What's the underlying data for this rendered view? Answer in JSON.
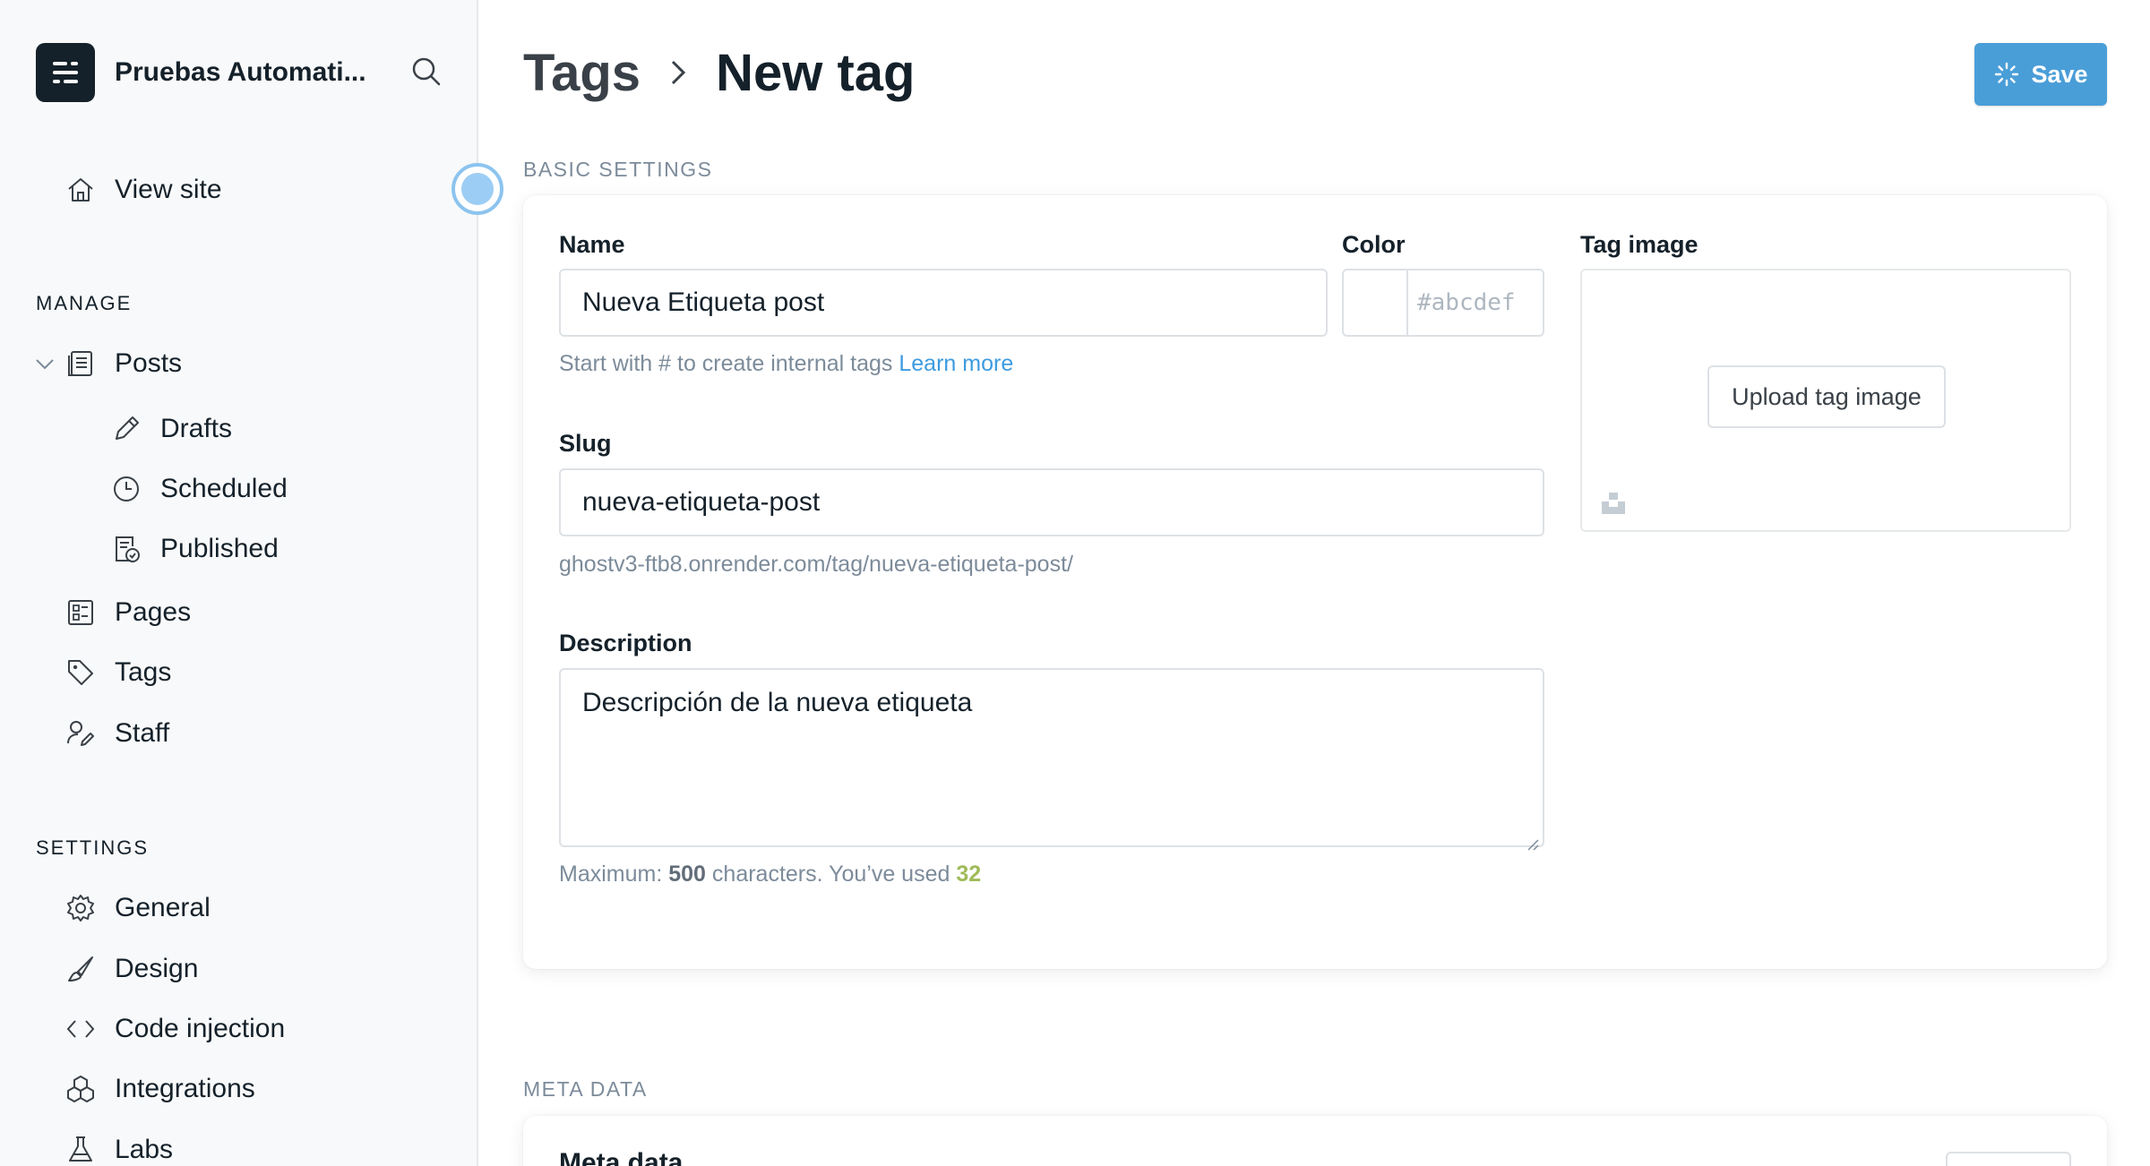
{
  "sidebar": {
    "site_name": "Pruebas Automati...",
    "view_site": "View site",
    "manage_heading": "MANAGE",
    "posts": "Posts",
    "drafts": "Drafts",
    "scheduled": "Scheduled",
    "published": "Published",
    "pages": "Pages",
    "tags": "Tags",
    "staff": "Staff",
    "settings_heading": "SETTINGS",
    "general": "General",
    "design": "Design",
    "code_injection": "Code injection",
    "integrations": "Integrations",
    "labs": "Labs"
  },
  "header": {
    "breadcrumb_parent": "Tags",
    "breadcrumb_current": "New tag",
    "save_label": "Save"
  },
  "basic": {
    "section_label": "BASIC SETTINGS",
    "name_label": "Name",
    "name_value": "Nueva Etiqueta post",
    "name_hint": "Start with # to create internal tags",
    "learn_more": "Learn more",
    "color_label": "Color",
    "color_placeholder": "#abcdef",
    "image_label": "Tag image",
    "upload_label": "Upload tag image",
    "slug_label": "Slug",
    "slug_value": "nueva-etiqueta-post",
    "slug_url": "ghostv3-ftb8.onrender.com/tag/nueva-etiqueta-post/",
    "description_label": "Description",
    "description_value": "Descripción de la nueva etiqueta",
    "desc_hint_prefix": "Maximum:",
    "desc_max": "500",
    "desc_hint_middle": "characters. You’ve used",
    "desc_used": "32"
  },
  "meta": {
    "section_label": "META DATA",
    "title": "Meta data"
  },
  "colors": {
    "accent": "#4a9ed8",
    "link": "#3d9be0",
    "count_green": "#9fbb58"
  }
}
